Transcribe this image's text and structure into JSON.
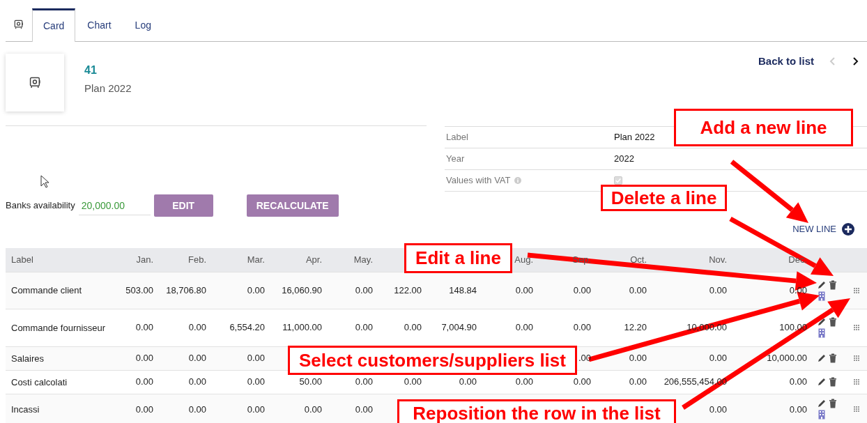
{
  "tabs": [
    {
      "label": "Card",
      "selected": true
    },
    {
      "label": "Chart",
      "selected": false
    },
    {
      "label": "Log",
      "selected": false
    }
  ],
  "record": {
    "number": "41",
    "name": "Plan 2022"
  },
  "navigation": {
    "back_label": "Back to list",
    "previous_disabled": true,
    "next_disabled": false
  },
  "fields": [
    {
      "label": "Label",
      "value": "Plan 2022",
      "kind": "text"
    },
    {
      "label": "Year",
      "value": "2022",
      "kind": "text"
    },
    {
      "label": "Values with VAT",
      "kind": "checkbox",
      "info": true,
      "checked": true,
      "disabled": true
    }
  ],
  "banks_availability": {
    "label": "Banks availability",
    "value": "20,000.00"
  },
  "buttons": [
    "EDIT",
    "RECALCULATE"
  ],
  "new_line_label": "NEW LINE",
  "table": {
    "columns": {
      "label": "Label",
      "jan": "Jan.",
      "feb": "Feb.",
      "mar": "Mar.",
      "apr": "Apr.",
      "may": "May.",
      "aug": "Aug.",
      "sep": "Sep.",
      "oct": "Oct.",
      "nov": "Nov.",
      "dec": "Dec."
    },
    "rows": [
      {
        "label": "Commande client",
        "values": {
          "jan": "503.00",
          "feb": "18,706.80",
          "mar": "0.00",
          "apr": "16,060.90",
          "may": "0.00",
          "jun": "122.00",
          "jul": "148.84",
          "aug": "0.00",
          "sep": "0.00",
          "oct": "0.00",
          "nov": "0.00",
          "dec": "0.00"
        },
        "customer_list": true
      },
      {
        "label": "Commande fournisseur",
        "values": {
          "jan": "0.00",
          "feb": "0.00",
          "mar": "6,554.20",
          "apr": "11,000.00",
          "may": "0.00",
          "jun": "0.00",
          "jul": "7,004.90",
          "aug": "0.00",
          "sep": "0.00",
          "oct": "12.20",
          "nov": "10,000.00",
          "dec": "100.00"
        },
        "customer_list": true
      },
      {
        "label": "Salaires",
        "values": {
          "jan": "0.00",
          "feb": "0.00",
          "mar": "0.00",
          "sep": ".00",
          "oct": "0.00",
          "nov": "0.00",
          "dec": "10,000.00"
        },
        "customer_list": false
      },
      {
        "label": "Costi calcolati",
        "values": {
          "jan": "0.00",
          "feb": "0.00",
          "mar": "0.00",
          "apr": "50.00",
          "may": "0.00",
          "jun": "0.00",
          "jul": "0.00",
          "aug": "0.00",
          "sep": "0.00",
          "oct": "0.00",
          "nov": "206,555,454.00",
          "dec": "0.00"
        },
        "customer_list": false
      },
      {
        "label": "Incassi",
        "values": {
          "jan": "0.00",
          "feb": "0.00",
          "mar": "0.00",
          "apr": "0.00",
          "may": "0.00",
          "nov": "0.00",
          "dec": "0.00"
        },
        "customer_list": true
      }
    ]
  },
  "annotations": [
    {
      "text": "Add a new line"
    },
    {
      "text": "Delete a line"
    },
    {
      "text": "Edit a line"
    },
    {
      "text": "Select customers/suppliers list"
    },
    {
      "text": "Reposition the row in the list"
    }
  ]
}
